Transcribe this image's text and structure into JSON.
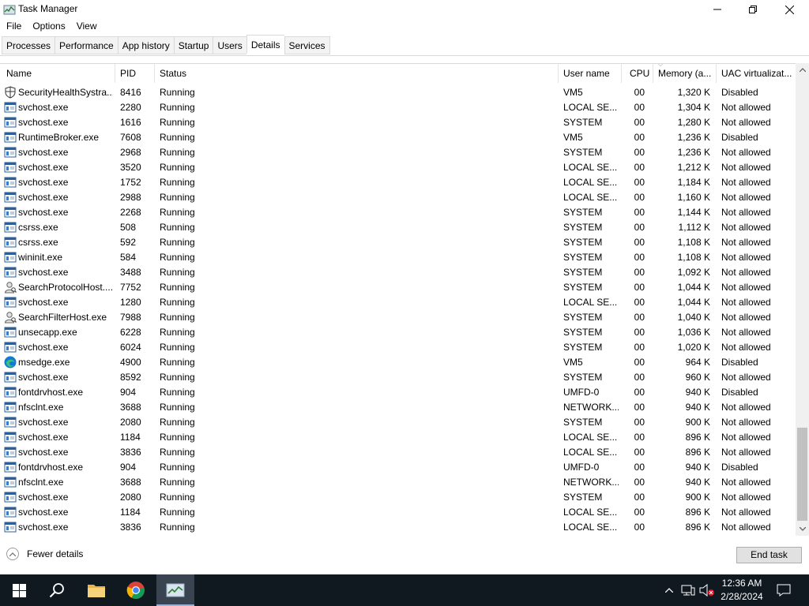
{
  "window": {
    "title": "Task Manager"
  },
  "menu": [
    "File",
    "Options",
    "View"
  ],
  "tabs": [
    "Processes",
    "Performance",
    "App history",
    "Startup",
    "Users",
    "Details",
    "Services"
  ],
  "active_tab": "Details",
  "columns": {
    "name": "Name",
    "pid": "PID",
    "status": "Status",
    "user": "User name",
    "cpu": "CPU",
    "memory": "Memory (a...",
    "uac": "UAC virtualizat..."
  },
  "rows": [
    {
      "icon": "shield-icon",
      "name": "SecurityHealthSystra...",
      "pid": "8416",
      "status": "Running",
      "user": "VM5",
      "cpu": "00",
      "memory": "1,320 K",
      "uac": "Disabled"
    },
    {
      "icon": "service-host-icon",
      "name": "svchost.exe",
      "pid": "2280",
      "status": "Running",
      "user": "LOCAL SE...",
      "cpu": "00",
      "memory": "1,304 K",
      "uac": "Not allowed"
    },
    {
      "icon": "service-host-icon",
      "name": "svchost.exe",
      "pid": "1616",
      "status": "Running",
      "user": "SYSTEM",
      "cpu": "00",
      "memory": "1,280 K",
      "uac": "Not allowed"
    },
    {
      "icon": "service-host-icon",
      "name": "RuntimeBroker.exe",
      "pid": "7608",
      "status": "Running",
      "user": "VM5",
      "cpu": "00",
      "memory": "1,236 K",
      "uac": "Disabled"
    },
    {
      "icon": "service-host-icon",
      "name": "svchost.exe",
      "pid": "2968",
      "status": "Running",
      "user": "SYSTEM",
      "cpu": "00",
      "memory": "1,236 K",
      "uac": "Not allowed"
    },
    {
      "icon": "service-host-icon",
      "name": "svchost.exe",
      "pid": "3520",
      "status": "Running",
      "user": "LOCAL SE...",
      "cpu": "00",
      "memory": "1,212 K",
      "uac": "Not allowed"
    },
    {
      "icon": "service-host-icon",
      "name": "svchost.exe",
      "pid": "1752",
      "status": "Running",
      "user": "LOCAL SE...",
      "cpu": "00",
      "memory": "1,184 K",
      "uac": "Not allowed"
    },
    {
      "icon": "service-host-icon",
      "name": "svchost.exe",
      "pid": "2988",
      "status": "Running",
      "user": "LOCAL SE...",
      "cpu": "00",
      "memory": "1,160 K",
      "uac": "Not allowed"
    },
    {
      "icon": "service-host-icon",
      "name": "svchost.exe",
      "pid": "2268",
      "status": "Running",
      "user": "SYSTEM",
      "cpu": "00",
      "memory": "1,144 K",
      "uac": "Not allowed"
    },
    {
      "icon": "service-host-icon",
      "name": "csrss.exe",
      "pid": "508",
      "status": "Running",
      "user": "SYSTEM",
      "cpu": "00",
      "memory": "1,112 K",
      "uac": "Not allowed"
    },
    {
      "icon": "service-host-icon",
      "name": "csrss.exe",
      "pid": "592",
      "status": "Running",
      "user": "SYSTEM",
      "cpu": "00",
      "memory": "1,108 K",
      "uac": "Not allowed"
    },
    {
      "icon": "service-host-icon",
      "name": "wininit.exe",
      "pid": "584",
      "status": "Running",
      "user": "SYSTEM",
      "cpu": "00",
      "memory": "1,108 K",
      "uac": "Not allowed"
    },
    {
      "icon": "service-host-icon",
      "name": "svchost.exe",
      "pid": "3488",
      "status": "Running",
      "user": "SYSTEM",
      "cpu": "00",
      "memory": "1,092 K",
      "uac": "Not allowed"
    },
    {
      "icon": "search-person-icon",
      "name": "SearchProtocolHost....",
      "pid": "7752",
      "status": "Running",
      "user": "SYSTEM",
      "cpu": "00",
      "memory": "1,044 K",
      "uac": "Not allowed"
    },
    {
      "icon": "service-host-icon",
      "name": "svchost.exe",
      "pid": "1280",
      "status": "Running",
      "user": "LOCAL SE...",
      "cpu": "00",
      "memory": "1,044 K",
      "uac": "Not allowed"
    },
    {
      "icon": "search-person-icon",
      "name": "SearchFilterHost.exe",
      "pid": "7988",
      "status": "Running",
      "user": "SYSTEM",
      "cpu": "00",
      "memory": "1,040 K",
      "uac": "Not allowed"
    },
    {
      "icon": "service-host-icon",
      "name": "unsecapp.exe",
      "pid": "6228",
      "status": "Running",
      "user": "SYSTEM",
      "cpu": "00",
      "memory": "1,036 K",
      "uac": "Not allowed"
    },
    {
      "icon": "service-host-icon",
      "name": "svchost.exe",
      "pid": "6024",
      "status": "Running",
      "user": "SYSTEM",
      "cpu": "00",
      "memory": "1,020 K",
      "uac": "Not allowed"
    },
    {
      "icon": "edge-icon",
      "name": "msedge.exe",
      "pid": "4900",
      "status": "Running",
      "user": "VM5",
      "cpu": "00",
      "memory": "964 K",
      "uac": "Disabled"
    },
    {
      "icon": "service-host-icon",
      "name": "svchost.exe",
      "pid": "8592",
      "status": "Running",
      "user": "SYSTEM",
      "cpu": "00",
      "memory": "960 K",
      "uac": "Not allowed"
    },
    {
      "icon": "service-host-icon",
      "name": "fontdrvhost.exe",
      "pid": "904",
      "status": "Running",
      "user": "UMFD-0",
      "cpu": "00",
      "memory": "940 K",
      "uac": "Disabled"
    },
    {
      "icon": "service-host-icon",
      "name": "nfsclnt.exe",
      "pid": "3688",
      "status": "Running",
      "user": "NETWORK...",
      "cpu": "00",
      "memory": "940 K",
      "uac": "Not allowed"
    },
    {
      "icon": "service-host-icon",
      "name": "svchost.exe",
      "pid": "2080",
      "status": "Running",
      "user": "SYSTEM",
      "cpu": "00",
      "memory": "900 K",
      "uac": "Not allowed"
    },
    {
      "icon": "service-host-icon",
      "name": "svchost.exe",
      "pid": "1184",
      "status": "Running",
      "user": "LOCAL SE...",
      "cpu": "00",
      "memory": "896 K",
      "uac": "Not allowed"
    },
    {
      "icon": "service-host-icon",
      "name": "svchost.exe",
      "pid": "3836",
      "status": "Running",
      "user": "LOCAL SE...",
      "cpu": "00",
      "memory": "896 K",
      "uac": "Not allowed"
    },
    {
      "icon": "service-host-icon",
      "name": "fontdrvhost.exe",
      "pid": "904",
      "status": "Running",
      "user": "UMFD-0",
      "cpu": "00",
      "memory": "940 K",
      "uac": "Disabled"
    },
    {
      "icon": "service-host-icon",
      "name": "nfsclnt.exe",
      "pid": "3688",
      "status": "Running",
      "user": "NETWORK...",
      "cpu": "00",
      "memory": "940 K",
      "uac": "Not allowed"
    },
    {
      "icon": "service-host-icon",
      "name": "svchost.exe",
      "pid": "2080",
      "status": "Running",
      "user": "SYSTEM",
      "cpu": "00",
      "memory": "900 K",
      "uac": "Not allowed"
    },
    {
      "icon": "service-host-icon",
      "name": "svchost.exe",
      "pid": "1184",
      "status": "Running",
      "user": "LOCAL SE...",
      "cpu": "00",
      "memory": "896 K",
      "uac": "Not allowed"
    },
    {
      "icon": "service-host-icon",
      "name": "svchost.exe",
      "pid": "3836",
      "status": "Running",
      "user": "LOCAL SE...",
      "cpu": "00",
      "memory": "896 K",
      "uac": "Not allowed"
    }
  ],
  "footer": {
    "fewer_details": "Fewer details",
    "end_task": "End task"
  },
  "taskbar": {
    "apps": [
      "start-icon",
      "search-icon",
      "file-explorer-icon",
      "chrome-icon",
      "task-manager-icon"
    ],
    "tray": [
      "chevron-up-icon",
      "network-icon",
      "volume-muted-icon",
      "notification-icon"
    ],
    "time": "12:36 AM",
    "date": "2/28/2024"
  },
  "colors": {
    "taskbar": "#101820",
    "edge": "#0f7bd4",
    "chrome_red": "#db4437",
    "folder": "#e8b445"
  }
}
